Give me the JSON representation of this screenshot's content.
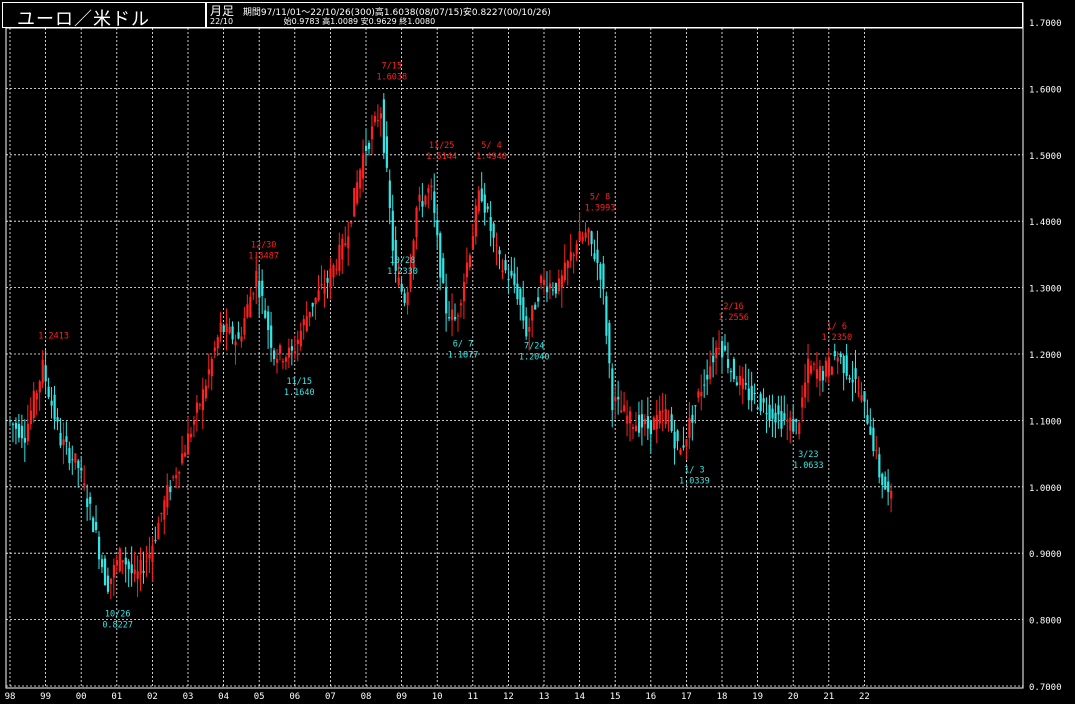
{
  "window": {
    "title": "ユーロ／米ドル",
    "period_label": "月足",
    "header_line1": "期間97/11/01〜22/10/26(300)高1.6038(08/07/15)安0.8227(00/10/26)",
    "header_date": "22/10",
    "header_ohlc": "始0.9783 高1.0089 安0.9629 終1.0080"
  },
  "colors": {
    "up": "#ff2020",
    "down": "#33e6e6",
    "grid": "#ffffff",
    "background": "#000000"
  },
  "chart_data": {
    "type": "candlestick",
    "title": "ユーロ／米ドル",
    "interval": "monthly",
    "ylim": [
      0.7,
      1.7
    ],
    "y_ticks": [
      "1.7000",
      "1.6000",
      "1.5000",
      "1.4000",
      "1.3000",
      "1.2000",
      "1.1000",
      "1.0000",
      "0.9000",
      "0.8000",
      "0.7000"
    ],
    "x_tick_labels": [
      "98",
      "99",
      "00",
      "01",
      "02",
      "03",
      "04",
      "05",
      "06",
      "07",
      "08",
      "09",
      "10",
      "11",
      "12",
      "13",
      "14",
      "15",
      "16",
      "17",
      "18",
      "19",
      "20",
      "21",
      "22"
    ],
    "grid": true,
    "series": [
      {
        "name": "EUR/USD",
        "x": [
          1998.0,
          1998.5,
          1999.0,
          1999.5,
          2000.0,
          2000.4,
          2000.8,
          2001.2,
          2001.6,
          2002.0,
          2002.5,
          2003.0,
          2003.5,
          2004.0,
          2004.5,
          2005.0,
          2005.5,
          2006.0,
          2006.5,
          2007.0,
          2007.5,
          2008.0,
          2008.5,
          2008.9,
          2009.2,
          2009.5,
          2009.9,
          2010.3,
          2010.6,
          2011.0,
          2011.3,
          2011.8,
          2012.3,
          2012.6,
          2013.0,
          2013.5,
          2014.0,
          2014.3,
          2014.7,
          2015.0,
          2015.5,
          2016.0,
          2016.5,
          2016.9,
          2017.5,
          2018.0,
          2018.4,
          2018.8,
          2019.3,
          2019.8,
          2020.2,
          2020.5,
          2020.9,
          2021.3,
          2021.8,
          2022.2,
          2022.5,
          2022.8
        ],
        "y": [
          1.1,
          1.08,
          1.18,
          1.07,
          1.03,
          0.95,
          0.85,
          0.9,
          0.86,
          0.9,
          0.99,
          1.06,
          1.14,
          1.24,
          1.22,
          1.32,
          1.2,
          1.2,
          1.27,
          1.31,
          1.37,
          1.5,
          1.57,
          1.32,
          1.28,
          1.42,
          1.45,
          1.27,
          1.25,
          1.36,
          1.45,
          1.34,
          1.3,
          1.23,
          1.31,
          1.3,
          1.37,
          1.38,
          1.32,
          1.13,
          1.1,
          1.09,
          1.11,
          1.05,
          1.15,
          1.22,
          1.17,
          1.14,
          1.12,
          1.1,
          1.09,
          1.18,
          1.17,
          1.2,
          1.16,
          1.1,
          1.02,
          0.98
        ]
      }
    ],
    "annotations": [
      {
        "date": "",
        "value": "1.2413",
        "x": 1999.0,
        "type": "high"
      },
      {
        "date": "10/26",
        "value": "0.8227",
        "x": 2000.8,
        "type": "low"
      },
      {
        "date": "12/30",
        "value": "1.3487",
        "x": 2004.9,
        "type": "high"
      },
      {
        "date": "11/15",
        "value": "1.1640",
        "x": 2005.9,
        "type": "low"
      },
      {
        "date": "7/15",
        "value": "1.6038",
        "x": 2008.5,
        "type": "high"
      },
      {
        "date": "10/28",
        "value": "1.2330",
        "x": 2008.8,
        "type": "low"
      },
      {
        "date": "11/25",
        "value": "1.5144",
        "x": 2009.9,
        "type": "high"
      },
      {
        "date": "5/ 4",
        "value": "1.4940",
        "x": 2011.3,
        "type": "high"
      },
      {
        "date": "6/ 7",
        "value": "1.1877",
        "x": 2010.5,
        "type": "low"
      },
      {
        "date": "7/24",
        "value": "1.2040",
        "x": 2012.5,
        "type": "low"
      },
      {
        "date": "5/ 8",
        "value": "1.3993",
        "x": 2014.35,
        "type": "high"
      },
      {
        "date": "1/ 3",
        "value": "1.0339",
        "x": 2017.0,
        "type": "low"
      },
      {
        "date": "2/16",
        "value": "1.2556",
        "x": 2018.1,
        "type": "high"
      },
      {
        "date": "3/23",
        "value": "1.0633",
        "x": 2020.2,
        "type": "low"
      },
      {
        "date": "1/ 6",
        "value": "1.2350",
        "x": 2021.0,
        "type": "high"
      }
    ]
  }
}
